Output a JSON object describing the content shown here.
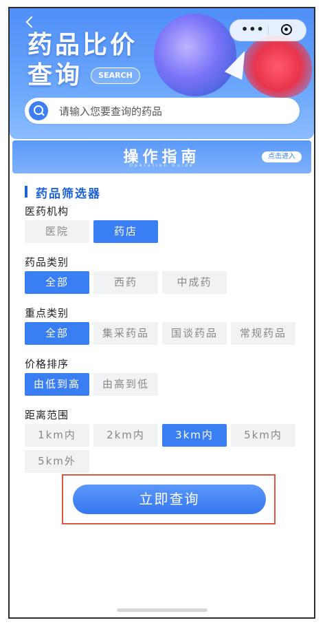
{
  "header": {
    "title_line1": "药品比价",
    "title_line2": "查询",
    "search_badge": "SEARCH",
    "capsule_more": "•••",
    "search_placeholder": "请输入您要查询的药品"
  },
  "guide": {
    "title": "操作指南",
    "subtitle": "Operation Guide",
    "enter_label": "点击进入"
  },
  "filter": {
    "title": "药品筛选器",
    "groups": [
      {
        "label": "医药机构",
        "options": [
          "医院",
          "药店"
        ],
        "selected": "药店"
      },
      {
        "label": "药品类别",
        "options": [
          "全部",
          "西药",
          "中成药"
        ],
        "selected": "全部"
      },
      {
        "label": "重点类别",
        "options": [
          "全部",
          "集采药品",
          "国谈药品",
          "常规药品"
        ],
        "selected": "全部"
      },
      {
        "label": "价格排序",
        "options": [
          "由低到高",
          "由高到低"
        ],
        "selected": "由低到高"
      },
      {
        "label": "距离范围",
        "options": [
          "1km内",
          "2km内",
          "3km内",
          "5km内",
          "5km外"
        ],
        "selected": "3km内"
      }
    ]
  },
  "actions": {
    "query_label": "立即查询"
  },
  "colors": {
    "accent": "#3a7ef4",
    "highlight_outline": "#e15441"
  }
}
